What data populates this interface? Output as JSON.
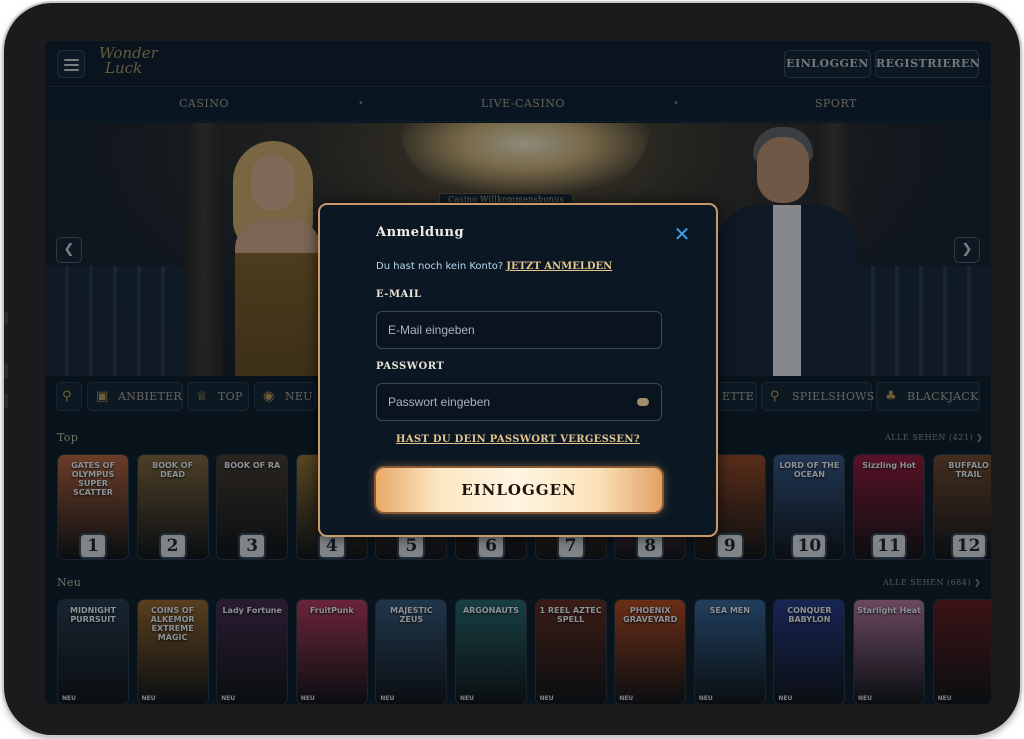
{
  "header": {
    "logo_line1": "Wonder",
    "logo_line2": "Luck",
    "login_label": "EINLOGGEN",
    "register_label": "REGISTRIEREN"
  },
  "nav": {
    "items": [
      "CASINO",
      "LIVE-CASINO",
      "SPORT"
    ],
    "separator": "•"
  },
  "banner": {
    "label": "Casino Willkommensbonus"
  },
  "categories": [
    {
      "label": "",
      "icon": "search-icon"
    },
    {
      "label": "ANBIETER",
      "icon": "book-icon"
    },
    {
      "label": "TOP",
      "icon": "crown-icon"
    },
    {
      "label": "NEU",
      "icon": "globe-icon"
    },
    {
      "label": "ETTE",
      "icon": "roulette-icon"
    },
    {
      "label": "SPIELSHOWS",
      "icon": "microphone-icon"
    },
    {
      "label": "BLACKJACK",
      "icon": "cards-icon"
    }
  ],
  "top_section": {
    "title": "Top",
    "see_all": "ALLE SEHEN (421)",
    "games": [
      {
        "title": "GATES OF OLYMPUS SUPER SCATTER",
        "rank": "1",
        "color": "#c0663a"
      },
      {
        "title": "BOOK OF DEAD",
        "rank": "2",
        "color": "#8a6a3a"
      },
      {
        "title": "BOOK OF RA",
        "rank": "3",
        "color": "#4a3a2a"
      },
      {
        "title": "",
        "rank": "4",
        "color": "#a07830"
      },
      {
        "title": "",
        "rank": "5",
        "color": "#9a5060"
      },
      {
        "title": "",
        "rank": "6",
        "color": "#7a2828"
      },
      {
        "title": "",
        "rank": "7",
        "color": "#c05a2a"
      },
      {
        "title": "",
        "rank": "8",
        "color": "#d06a90"
      },
      {
        "title": "",
        "rank": "9",
        "color": "#a04a20"
      },
      {
        "title": "LORD OF THE OCEAN",
        "rank": "10",
        "color": "#3a5a8a"
      },
      {
        "title": "Sizzling Hot",
        "rank": "11",
        "color": "#a01838"
      },
      {
        "title": "BUFFALO TRAIL",
        "rank": "12",
        "color": "#7a4a2a"
      }
    ]
  },
  "new_section": {
    "title": "Neu",
    "see_all": "ALLE SEHEN (684)",
    "badge": "NEU",
    "games": [
      {
        "title": "MIDNIGHT PURRSUIT",
        "color": "#2a3a4a"
      },
      {
        "title": "COINS OF ALKEMOR EXTREME MAGIC",
        "color": "#a06a2a"
      },
      {
        "title": "Lady Fortune",
        "color": "#4a2a4a"
      },
      {
        "title": "FruitPunk",
        "color": "#c03a5a"
      },
      {
        "title": "MAJESTIC ZEUS",
        "color": "#3a5a7a"
      },
      {
        "title": "ARGONAUTS",
        "color": "#2a6a6a"
      },
      {
        "title": "1 REEL AZTEC SPELL",
        "color": "#6a2a1a"
      },
      {
        "title": "PHOENIX GRAVEYARD",
        "color": "#c04a1a"
      },
      {
        "title": "SEA MEN",
        "color": "#3a6a9a"
      },
      {
        "title": "CONQUER BABYLON",
        "color": "#2a3a8a"
      },
      {
        "title": "Starlight Heat",
        "color": "#c07aa0"
      },
      {
        "title": "",
        "color": "#6a1a1a"
      }
    ]
  },
  "modal": {
    "title": "Anmeldung",
    "no_account_text": "Du hast noch kein Konto?",
    "signup_link": "JETZT ANMELDEN",
    "email_label": "E-MAIL",
    "email_placeholder": "E-Mail eingeben",
    "password_label": "PASSWORT",
    "password_placeholder": "Passwort eingeben",
    "forgot_link": "HAST DU DEIN PASSWORT VERGESSEN?",
    "login_button": "EINLOGGEN"
  }
}
